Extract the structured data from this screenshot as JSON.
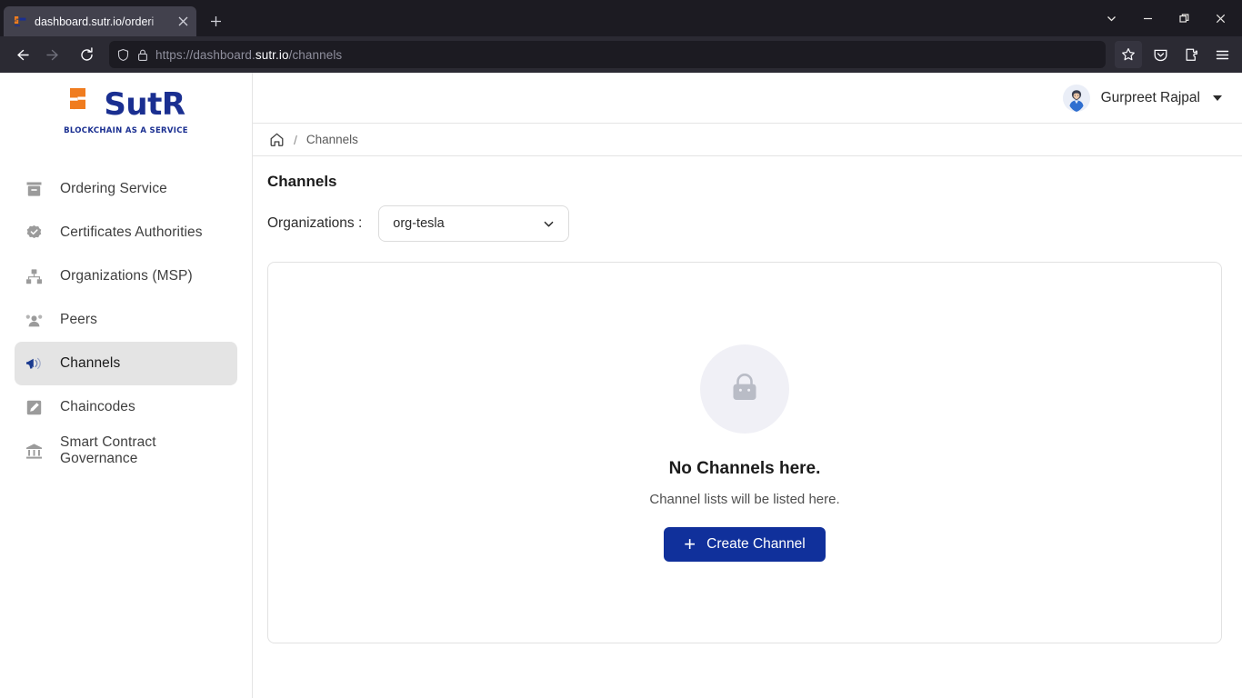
{
  "browser": {
    "tab": {
      "title": "dashboard.sutr.io/orderi",
      "favicon": "sutr-logo-favicon",
      "close_label": "×"
    },
    "new_tab_label": "+",
    "nav": {
      "back": "back-arrow",
      "forward": "forward-arrow",
      "reload": "reload-icon"
    },
    "url": {
      "prefix": "https://dashboard.",
      "host": "sutr.io",
      "path": "/channels",
      "shield_icon": "shield-icon",
      "lock_icon": "lock-icon"
    },
    "toolbar": {
      "bookmark": "star-icon",
      "pocket": "pocket-icon",
      "extensions": "extensions-icon",
      "menu": "hamburger-menu-icon"
    },
    "window_controls": {
      "tab_list": "chevron-down",
      "minimize": "minimize",
      "maximize": "maximize",
      "close": "close"
    }
  },
  "sidebar": {
    "logo": {
      "text": "SutR",
      "tagline": "BLOCKCHAIN AS A SERVICE",
      "mark_color": "#f07c1f",
      "text_color": "#1a2f91"
    },
    "items": [
      {
        "label": "Ordering Service",
        "icon": "archive-box-icon",
        "active": false
      },
      {
        "label": "Certificates Authorities",
        "icon": "verified-badge-icon",
        "active": false
      },
      {
        "label": "Organizations (MSP)",
        "icon": "sitemap-icon",
        "active": false
      },
      {
        "label": "Peers",
        "icon": "peers-icon",
        "active": false
      },
      {
        "label": "Channels",
        "icon": "megaphone-icon",
        "active": true
      },
      {
        "label": "Chaincodes",
        "icon": "chaincode-tag-icon",
        "active": false
      },
      {
        "label": "Smart Contract Governance",
        "icon": "bank-icon",
        "active": false
      }
    ],
    "active_bg": "#e4e4e4",
    "active_icon_color": "#1a3a8f"
  },
  "topbar": {
    "user_name": "Gurpreet Rajpal",
    "avatar": "user-avatar",
    "dropdown": "caret-down-icon"
  },
  "breadcrumb": {
    "home_icon": "home-icon",
    "separator": "/",
    "current": "Channels"
  },
  "main": {
    "page_title": "Channels",
    "organizations_label": "Organizations :",
    "organization_selected": "org-tesla",
    "select_caret": "chevron-down-icon",
    "empty_state": {
      "illustration": "shopping-bag-icon",
      "title": "No Channels here.",
      "subtitle": "Channel lists will be listed here.",
      "button_label": "Create Channel",
      "button_plus": "+",
      "button_color": "#10309b"
    }
  }
}
